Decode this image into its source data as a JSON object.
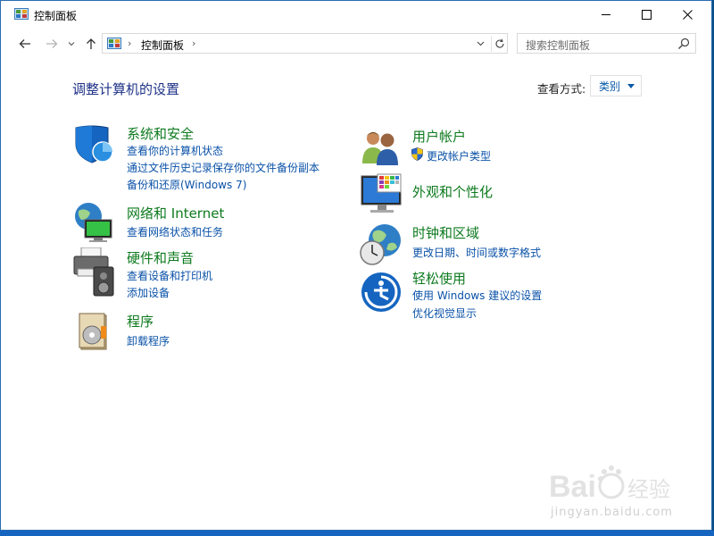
{
  "window": {
    "title": "控制面板"
  },
  "address": {
    "path_item": "控制面板",
    "separator": "›"
  },
  "search": {
    "placeholder": "搜索控制面板"
  },
  "content": {
    "heading": "调整计算机的设置",
    "view_by_label": "查看方式:",
    "view_by_value": "类别"
  },
  "categories": {
    "system_security": {
      "title": "系统和安全",
      "links": [
        "查看你的计算机状态",
        "通过文件历史记录保存你的文件备份副本",
        "备份和还原(Windows 7)"
      ]
    },
    "network": {
      "title": "网络和 Internet",
      "links": [
        "查看网络状态和任务"
      ]
    },
    "hardware": {
      "title": "硬件和声音",
      "links": [
        "查看设备和打印机",
        "添加设备"
      ]
    },
    "programs": {
      "title": "程序",
      "links": [
        "卸载程序"
      ]
    },
    "user_accounts": {
      "title": "用户帐户",
      "links": [
        "更改帐户类型"
      ]
    },
    "appearance": {
      "title": "外观和个性化",
      "links": []
    },
    "clock_region": {
      "title": "时钟和区域",
      "links": [
        "更改日期、时间或数字格式"
      ]
    },
    "ease_of_access": {
      "title": "轻松使用",
      "links": [
        "使用 Windows 建议的设置",
        "优化视觉显示"
      ]
    }
  },
  "watermark": {
    "text": "jingyan.baidu.com"
  },
  "icons": {
    "title": "control-panel-icon",
    "back": "arrow-left-icon",
    "forward": "arrow-right-icon",
    "recent": "chevron-down-icon",
    "up": "arrow-up-icon",
    "refresh": "refresh-icon",
    "search": "magnifier-icon"
  },
  "colors": {
    "category_title": "#0d7a1e",
    "link": "#0a52a8",
    "heading": "#1e3287",
    "frame": "#2b6cb0"
  }
}
